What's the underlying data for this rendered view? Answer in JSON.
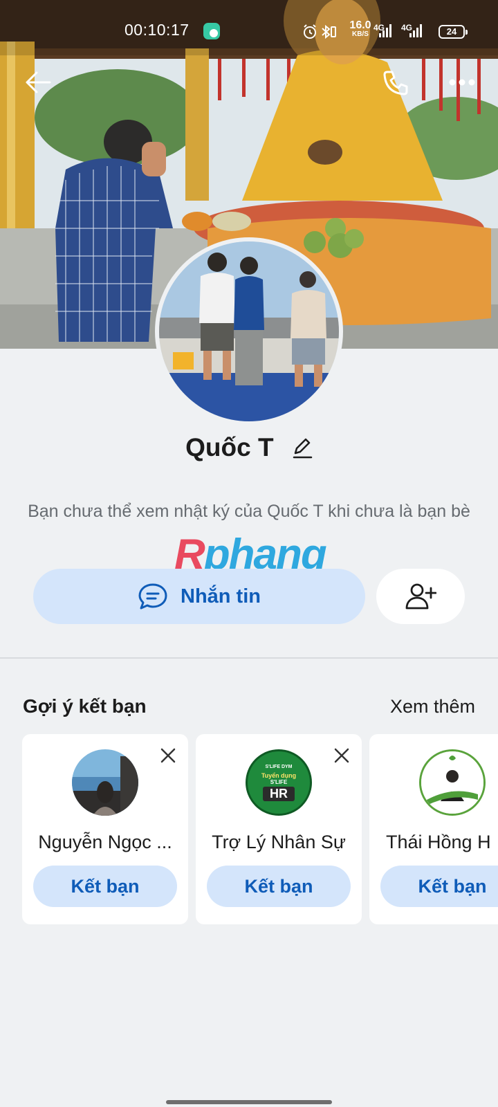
{
  "status_bar": {
    "time": "00:10:17",
    "net_speed_value": "16.0",
    "net_speed_unit": "KB/S",
    "signal1_label": "4G",
    "signal2_label": "4G",
    "battery": "24"
  },
  "top_bar": {
    "back_icon": "arrow-left-icon",
    "call_icon": "phone-icon",
    "more_icon": "more-dots-icon"
  },
  "profile": {
    "name": "Quốc T",
    "privacy_note": "Bạn chưa thể xem nhật ký của Quốc T khi chưa là bạn bè"
  },
  "watermark": {
    "first": "R",
    "rest": "phang"
  },
  "actions": {
    "message_label": "Nhắn tin",
    "message_icon": "chat-bubble-icon",
    "add_friend_icon": "add-person-icon"
  },
  "suggestions": {
    "title": "Gợi ý kết bạn",
    "see_more": "Xem thêm",
    "cards": [
      {
        "name": "Nguyễn Ngọc ...",
        "button": "Kết bạn"
      },
      {
        "name": "Trợ Lý Nhân Sự",
        "button": "Kết bạn",
        "avatar_text_top": "S'LIFE DYM",
        "avatar_text_mid": "Tuyển dụng",
        "avatar_text_sub": "S'LIFE",
        "avatar_text_big": "HR"
      },
      {
        "name": "Thái Hồng H",
        "button": "Kết bạn"
      }
    ]
  },
  "colors": {
    "accent": "#0f5cb8",
    "button_bg": "#d4e5fb",
    "page_bg": "#eff1f3"
  }
}
